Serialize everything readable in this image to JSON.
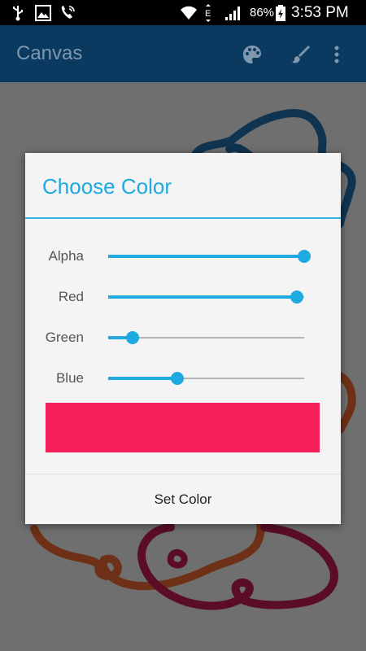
{
  "status_bar": {
    "battery_percent": "86%",
    "time": "3:53 PM",
    "network_type": "E",
    "icons": [
      "usb-icon",
      "image-notification-icon",
      "wifi-call-icon",
      "wifi-icon",
      "data-activity-icon",
      "signal-icon",
      "battery-charging-icon"
    ]
  },
  "action_bar": {
    "title": "Canvas",
    "icons": [
      "palette-icon",
      "brush-icon",
      "overflow-menu-icon"
    ]
  },
  "dialog": {
    "title": "Choose Color",
    "sliders": [
      {
        "label": "Alpha",
        "value": 255,
        "max": 255
      },
      {
        "label": "Red",
        "value": 245,
        "max": 255
      },
      {
        "label": "Green",
        "value": 32,
        "max": 255
      },
      {
        "label": "Blue",
        "value": 90,
        "max": 255
      }
    ],
    "preview_color": "#f5205a",
    "button_label": "Set Color"
  },
  "colors": {
    "accent": "#1ea9e1",
    "action_bar_dimmed": "#0b3a60",
    "scrim_background": "#6f6f6f",
    "stroke_blue": "#0e3452",
    "stroke_orange": "#6e3016",
    "stroke_maroon": "#5b0d28"
  }
}
